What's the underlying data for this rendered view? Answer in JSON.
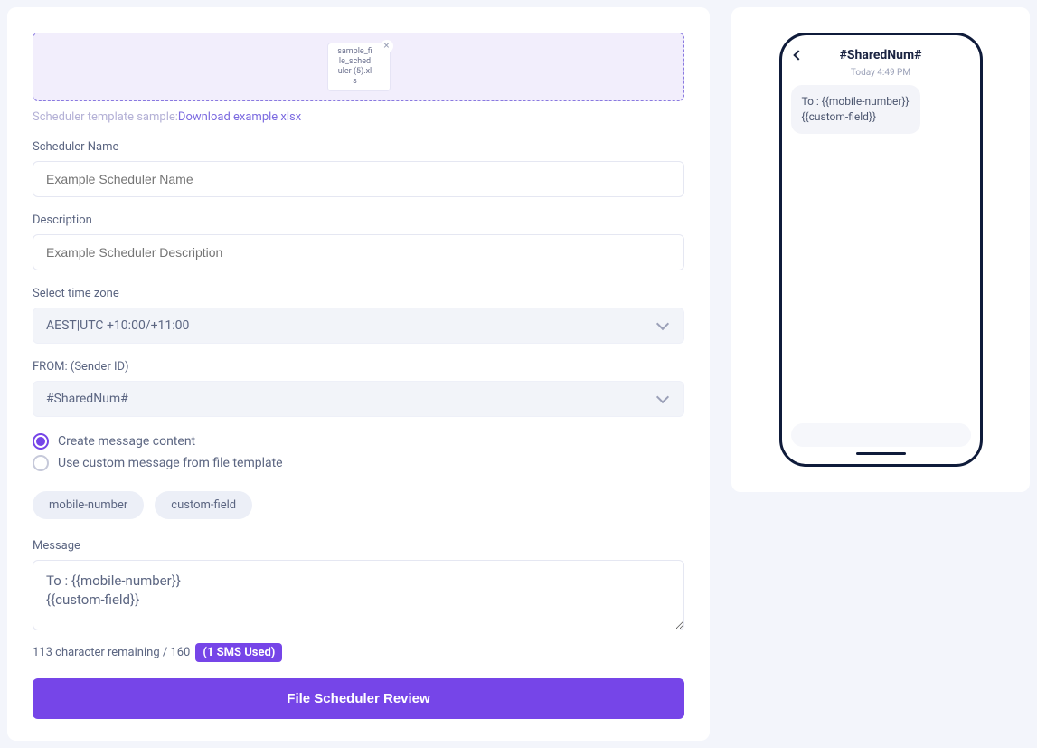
{
  "dropzone": {
    "file_name": "sample_file_scheduler (5).xls"
  },
  "sample": {
    "prefix": "Scheduler template sample:",
    "link": "Download example xlsx"
  },
  "scheduler_name": {
    "label": "Scheduler Name",
    "placeholder": "Example Scheduler Name"
  },
  "description": {
    "label": "Description",
    "placeholder": "Example Scheduler Description"
  },
  "timezone": {
    "label": "Select time zone",
    "value": "AEST|UTC +10:00/+11:00"
  },
  "sender": {
    "label": "FROM: (Sender ID)",
    "value": "#SharedNum#"
  },
  "radios": {
    "create": "Create message content",
    "file": "Use custom message from file template"
  },
  "pills": {
    "mobile": "mobile-number",
    "custom": "custom-field"
  },
  "message": {
    "label": "Message",
    "value": "To : {{mobile-number}}\n{{custom-field}}"
  },
  "counter": {
    "text": "113 character remaining / 160",
    "badge": "(1 SMS Used)"
  },
  "submit": "File Scheduler Review",
  "preview": {
    "title": "#SharedNum#",
    "timestamp": "Today 4:49 PM",
    "bubble": "To : {{mobile-number}}\n{{custom-field}}"
  }
}
